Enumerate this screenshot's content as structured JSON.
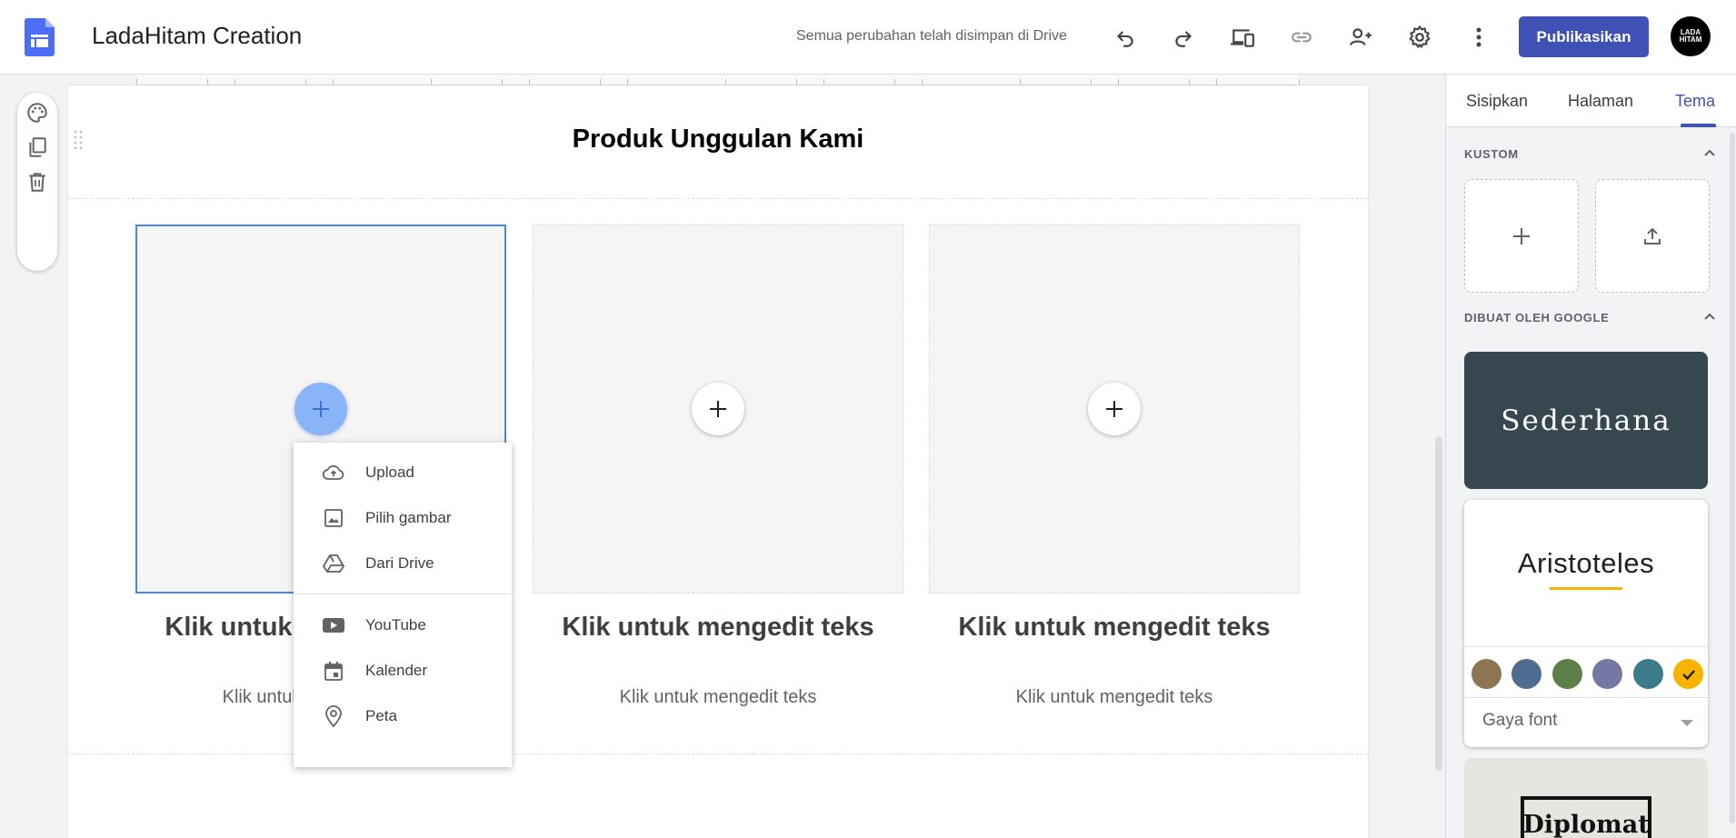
{
  "header": {
    "title": "LadaHitam Creation",
    "save_status": "Semua perubahan telah disimpan di Drive",
    "publish_label": "Publikasikan",
    "avatar_text": "LADA HITAM",
    "icons": [
      "undo-icon",
      "redo-icon",
      "preview-devices-icon",
      "link-icon",
      "share-person-add-icon",
      "settings-gear-icon",
      "more-vert-icon"
    ]
  },
  "section": {
    "title": "Produk Unggulan Kami",
    "tools": [
      "palette-icon",
      "duplicate-icon",
      "delete-icon"
    ],
    "cards": [
      {
        "heading": "Klik untuk mengedit teks",
        "text": "Klik untuk mengedit teks"
      },
      {
        "heading": "Klik untuk mengedit teks",
        "text": "Klik untuk mengedit teks"
      },
      {
        "heading": "Klik untuk mengedit teks",
        "text": "Klik untuk mengedit teks"
      }
    ]
  },
  "insert_menu": {
    "items": [
      {
        "label": "Upload",
        "icon": "cloud-upload-icon"
      },
      {
        "label": "Pilih gambar",
        "icon": "image-icon"
      },
      {
        "label": "Dari Drive",
        "icon": "drive-icon"
      },
      {
        "label": "YouTube",
        "icon": "youtube-icon"
      },
      {
        "label": "Kalender",
        "icon": "calendar-icon"
      },
      {
        "label": "Peta",
        "icon": "map-pin-icon"
      }
    ]
  },
  "panel": {
    "tabs": [
      {
        "label": "Sisipkan",
        "active": false
      },
      {
        "label": "Halaman",
        "active": false
      },
      {
        "label": "Tema",
        "active": true
      }
    ],
    "custom_label": "KUSTOM",
    "google_label": "DIBUAT OLEH GOOGLE",
    "themes": [
      {
        "name": "Sederhana"
      },
      {
        "name": "Aristoteles",
        "selected": true,
        "accent": "#f4b400",
        "swatches": [
          "#8d7553",
          "#4f6d8f",
          "#5c7f48",
          "#7578a3",
          "#3d7a8a",
          "#f4b400"
        ],
        "selected_swatch": 5,
        "font_style_label": "Gaya font"
      },
      {
        "name": "Diplomat"
      }
    ]
  },
  "colors": {
    "accent": "#3f51b5",
    "selection": "#4a86e8",
    "active_add_button": "#8ab4f8"
  }
}
